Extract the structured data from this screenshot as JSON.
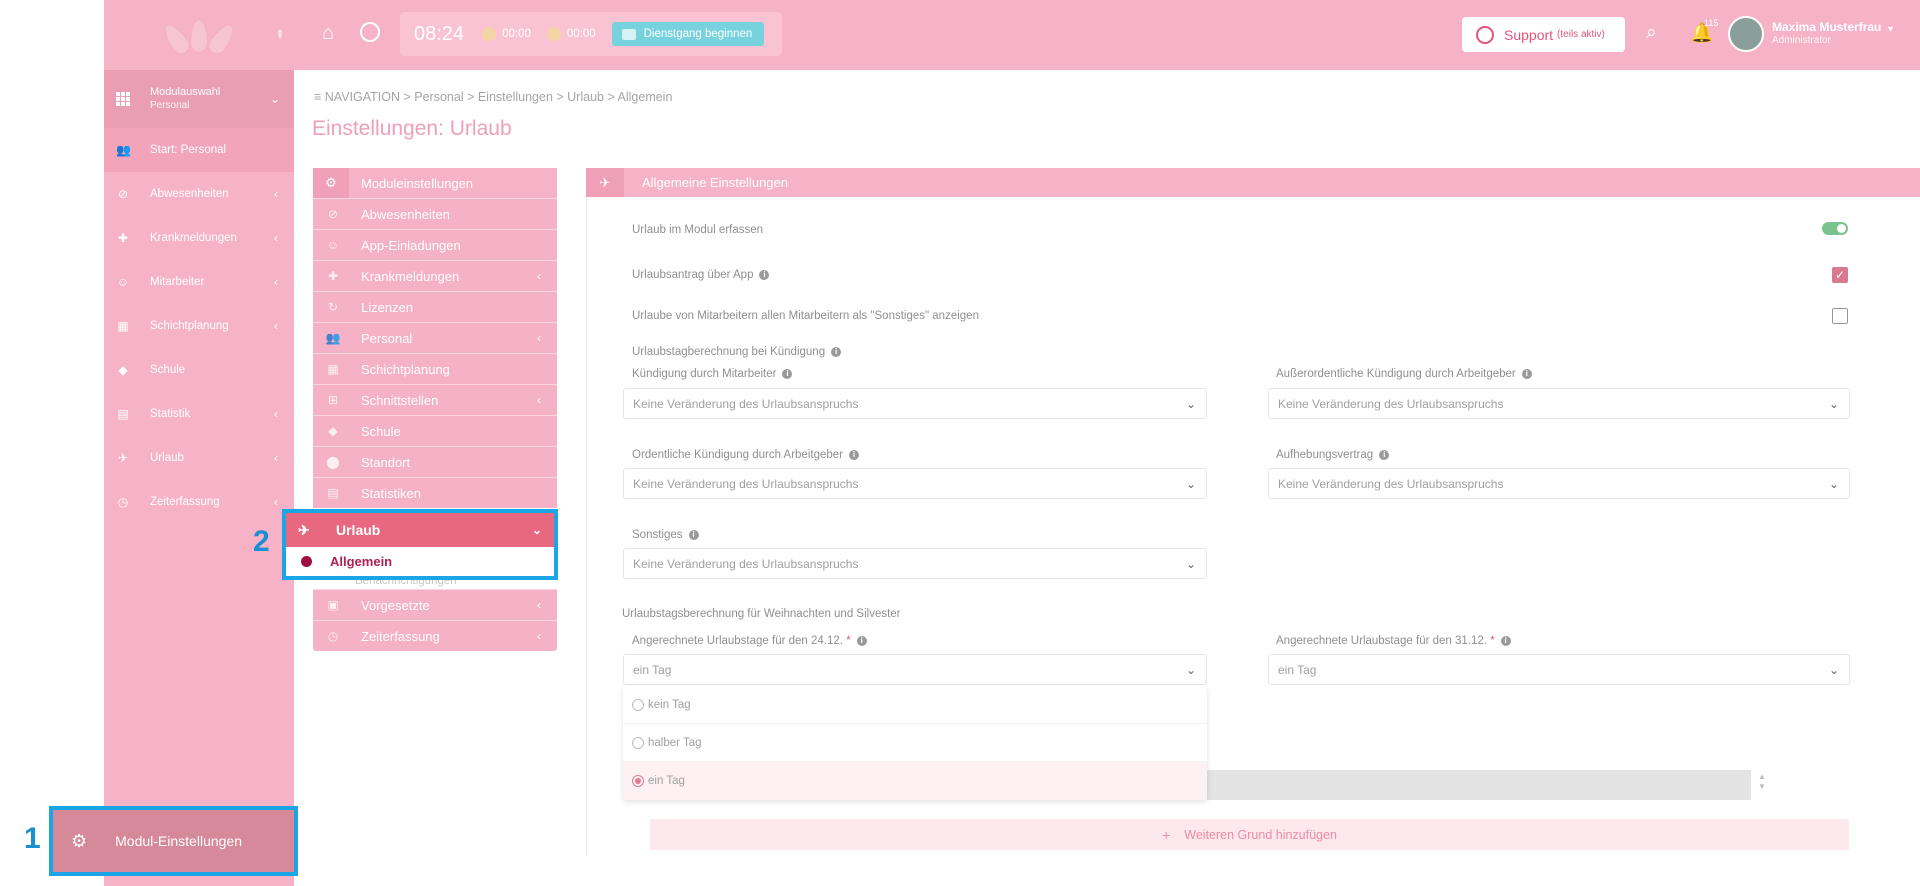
{
  "topbar": {
    "clock": "08:24",
    "timer1": "00:00",
    "timer2": "00:00",
    "duty_button": "Dienstgang beginnen",
    "support_label": "Support",
    "support_sub": "(teils aktiv)",
    "notification_count": "115",
    "user_name": "Maxima Musterfrau",
    "user_role": "Administrator"
  },
  "sidebar": {
    "module_title": "Modulauswahl",
    "module_sub": "Personal",
    "items": [
      {
        "label": "Start: Personal",
        "icon": "users-icon"
      },
      {
        "label": "Abwesenheiten",
        "icon": "ban-icon"
      },
      {
        "label": "Krankmeldungen",
        "icon": "medical-icon"
      },
      {
        "label": "Mitarbeiter",
        "icon": "user-icon"
      },
      {
        "label": "Schichtplanung",
        "icon": "calendar-icon"
      },
      {
        "label": "Schule",
        "icon": "graduation-icon"
      },
      {
        "label": "Statistik",
        "icon": "chart-icon"
      },
      {
        "label": "Urlaub",
        "icon": "plane-icon"
      },
      {
        "label": "Zeiterfassung",
        "icon": "clock-icon"
      }
    ],
    "bottom_label": "Modul-Einstellungen"
  },
  "callouts": {
    "one": "1",
    "two": "2"
  },
  "breadcrumb": "NAVIGATION > Personal > Einstellungen > Urlaub > Allgemein",
  "page_title": "Einstellungen: Urlaub",
  "module_nav": {
    "header": "Moduleinstellungen",
    "items": [
      {
        "label": "Abwesenheiten"
      },
      {
        "label": "App-Einladungen"
      },
      {
        "label": "Krankmeldungen"
      },
      {
        "label": "Lizenzen"
      },
      {
        "label": "Personal"
      },
      {
        "label": "Schichtplanung"
      },
      {
        "label": "Schnittstellen"
      },
      {
        "label": "Schule"
      },
      {
        "label": "Standort"
      },
      {
        "label": "Statistiken"
      }
    ],
    "active": "Urlaub",
    "active_sub": "Allgemein",
    "ghost": "Benachrichtigungen",
    "bottom_items": [
      {
        "label": "Vorgesetzte"
      },
      {
        "label": "Zeiterfassung"
      }
    ]
  },
  "panel": {
    "header": "Allgemeine Einstellungen",
    "row1": "Urlaub im Modul erfassen",
    "row2": "Urlaubsantrag über App",
    "row3": "Urlaube von Mitarbeitern allen Mitarbeitern als \"Sonstiges\" anzeigen",
    "section1": "Urlaubstagberechnung bei Kündigung",
    "f1_label": "Kündigung durch Mitarbeiter",
    "f2_label": "Außerordentliche Kündigung durch Arbeitgeber",
    "f3_label": "Ordentliche Kündigung durch Arbeitgeber",
    "f4_label": "Aufhebungsvertrag",
    "f5_label": "Sonstiges",
    "select_value": "Keine Veränderung des Urlaubsanspruchs",
    "section2": "Urlaubstagsberechnung für Weihnachten und Silvester",
    "f6_label": "Angerechnete Urlaubstage für den 24.12.",
    "f7_label": "Angerechnete Urlaubstage für den 31.12.",
    "required_mark": "*",
    "f6_value": "ein Tag",
    "f7_value": "ein Tag",
    "options": [
      "kein Tag",
      "halber Tag",
      "ein Tag"
    ],
    "add_button": "Weiteren Grund hinzufügen"
  },
  "colors": {
    "accent": "#f6b3c8",
    "highlight": "#1aa6e6",
    "active": "#e8697f"
  }
}
